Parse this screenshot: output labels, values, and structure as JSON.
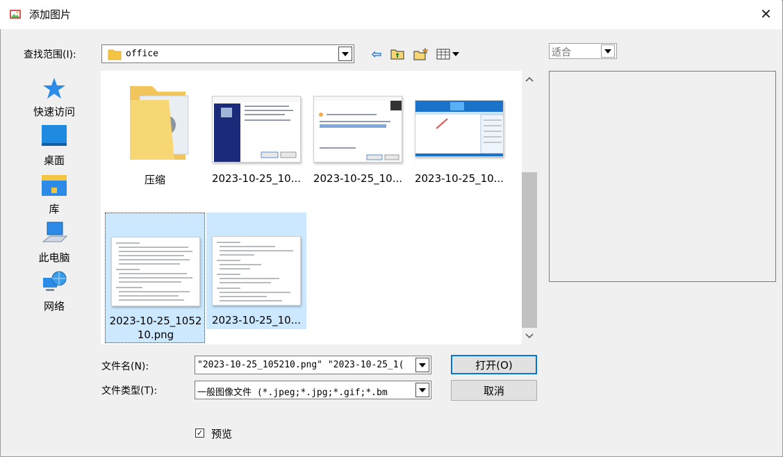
{
  "window": {
    "title": "添加图片",
    "close_glyph": "✕"
  },
  "lookin": {
    "label": "查找范围(I):",
    "value": "office",
    "toolbar": {
      "back_glyph": "⇦"
    }
  },
  "places": [
    {
      "label": "快速访问",
      "icon": "star-icon"
    },
    {
      "label": "桌面",
      "icon": "desktop-icon"
    },
    {
      "label": "库",
      "icon": "library-icon"
    },
    {
      "label": "此电脑",
      "icon": "computer-icon"
    },
    {
      "label": "网络",
      "icon": "network-icon"
    }
  ],
  "files": [
    {
      "name": "压缩",
      "type": "folder",
      "selected": false
    },
    {
      "name": "2023-10-25_10...",
      "type": "image",
      "selected": false
    },
    {
      "name": "2023-10-25_10...",
      "type": "image",
      "selected": false
    },
    {
      "name": "2023-10-25_10...",
      "type": "image",
      "selected": false
    },
    {
      "name_line1": "2023-10-25_1052",
      "name_line2": "10.png",
      "type": "image",
      "selected": true,
      "focused": true
    },
    {
      "name": "2023-10-25_10...",
      "type": "image",
      "selected": true
    }
  ],
  "filename": {
    "label": "文件名(N):",
    "value": "\"2023-10-25_105210.png\" \"2023-10-25_1("
  },
  "filetype": {
    "label": "文件类型(T):",
    "value": "一般图像文件 (*.jpeg;*.jpg;*.gif;*.bm"
  },
  "buttons": {
    "open": "打开(O)",
    "cancel": "取消"
  },
  "preview": {
    "fit_value": "适合",
    "checkbox_label": "预览",
    "checked": true,
    "check_glyph": "✓"
  },
  "colors": {
    "selection": "#cce8ff",
    "accent": "#0078d7",
    "folder": "#f4c542"
  }
}
